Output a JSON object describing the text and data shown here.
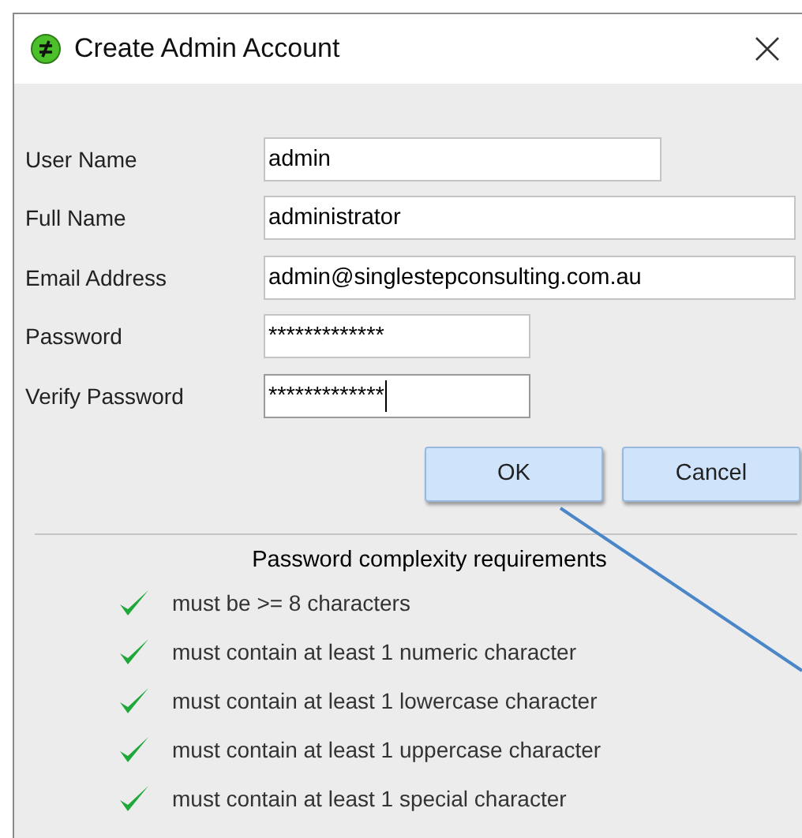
{
  "window": {
    "title": "Create Admin Account"
  },
  "fields": [
    {
      "label": "User Name",
      "value": "admin",
      "focused": false
    },
    {
      "label": "Full Name",
      "value": "administrator",
      "focused": false
    },
    {
      "label": "Email Address",
      "value": "admin@singlestepconsulting.com.au",
      "focused": false
    },
    {
      "label": "Password",
      "value": "*************",
      "focused": false
    },
    {
      "label": "Verify Password",
      "value": "*************",
      "focused": true
    }
  ],
  "buttons": [
    "OK",
    "Cancel"
  ],
  "requirements": {
    "title": "Password complexity requirements",
    "items": [
      {
        "text": "must be >= 8 characters",
        "met": true
      },
      {
        "text": "must contain at least 1 numeric character",
        "met": true
      },
      {
        "text": "must contain at least 1 lowercase character",
        "met": true
      },
      {
        "text": "must contain at least 1 uppercase character",
        "met": true
      },
      {
        "text": "must contain at least 1 special character",
        "met": true
      }
    ]
  }
}
